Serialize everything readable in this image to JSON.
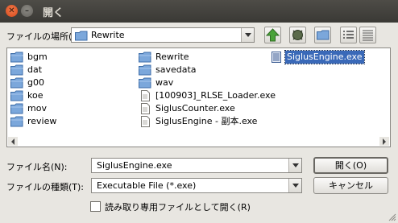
{
  "window": {
    "title": "開く",
    "close_glyph": "✕",
    "minimize_glyph": "–"
  },
  "lookin": {
    "label": "ファイルの場所(I",
    "value": "Rewrite"
  },
  "files": [
    {
      "name": "bgm",
      "type": "folder"
    },
    {
      "name": "dat",
      "type": "folder"
    },
    {
      "name": "g00",
      "type": "folder"
    },
    {
      "name": "koe",
      "type": "folder"
    },
    {
      "name": "mov",
      "type": "folder"
    },
    {
      "name": "review",
      "type": "folder"
    },
    {
      "name": "Rewrite",
      "type": "folder"
    },
    {
      "name": "savedata",
      "type": "folder"
    },
    {
      "name": "wav",
      "type": "folder"
    },
    {
      "name": "[100903]_RLSE_Loader.exe",
      "type": "file"
    },
    {
      "name": "SiglusCounter.exe",
      "type": "file"
    },
    {
      "name": "SiglusEngine - 副本.exe",
      "type": "file"
    },
    {
      "name": "SiglusEngine.exe",
      "type": "exe",
      "selected": true
    }
  ],
  "filename": {
    "label": "ファイル名(N):",
    "value": "SiglusEngine.exe"
  },
  "filetype": {
    "label": "ファイルの種類(T):",
    "value": "Executable File (*.exe)"
  },
  "buttons": {
    "open": "開く(O)",
    "cancel": "キャンセル"
  },
  "readonly": {
    "label": "読み取り専用ファイルとして開く(R)",
    "checked": false
  },
  "colors": {
    "selection": "#3a69b8",
    "folder": "#6f9fd6",
    "up_arrow": "#4aa33a"
  }
}
